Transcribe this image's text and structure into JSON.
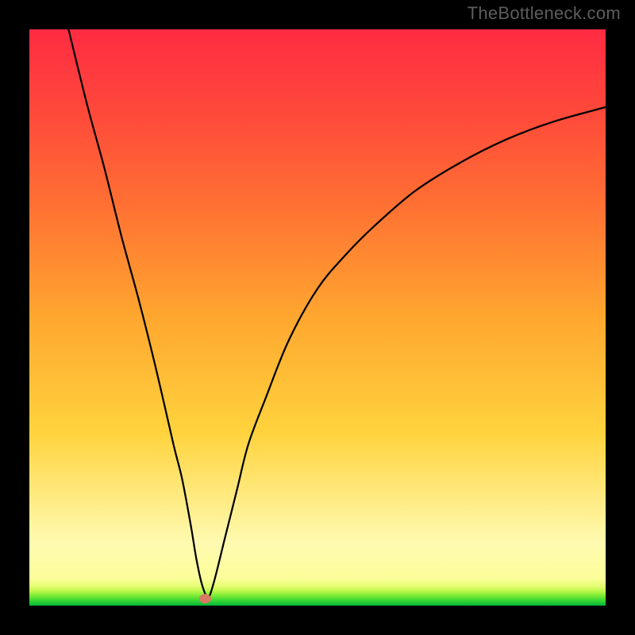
{
  "watermark": "TheBottleneck.com",
  "chart_data": {
    "type": "line",
    "title": "",
    "xlabel": "",
    "ylabel": "",
    "xlim": [
      0,
      100
    ],
    "ylim": [
      0,
      100
    ],
    "description": "V-shaped bottleneck curve on a vertical gradient (green at bottom through yellow/orange to red at top). Single marker dot at the curve minimum.",
    "background_gradient_stops": [
      {
        "pos": 0.0,
        "color": "#03b638"
      },
      {
        "pos": 0.008,
        "color": "#32d434"
      },
      {
        "pos": 0.017,
        "color": "#78ea34"
      },
      {
        "pos": 0.025,
        "color": "#b9f749"
      },
      {
        "pos": 0.034,
        "color": "#e6fd72"
      },
      {
        "pos": 0.048,
        "color": "#fcfe9b"
      },
      {
        "pos": 0.11,
        "color": "#fffab0"
      },
      {
        "pos": 0.3,
        "color": "#ffd33d"
      },
      {
        "pos": 0.5,
        "color": "#ffa72f"
      },
      {
        "pos": 0.7,
        "color": "#ff6f33"
      },
      {
        "pos": 0.85,
        "color": "#ff4a3a"
      },
      {
        "pos": 1.0,
        "color": "#ff2b42"
      }
    ],
    "series": [
      {
        "name": "bottleneck-curve",
        "x": [
          6.8,
          10,
          13,
          16,
          19,
          22,
          25,
          26.5,
          28,
          29,
          30,
          31,
          32,
          34,
          36,
          38,
          41,
          45,
          50,
          55,
          60,
          67,
          75,
          83,
          91,
          100
        ],
        "y": [
          100,
          87,
          76,
          64,
          53,
          41,
          28,
          22,
          14,
          8,
          3.5,
          1.5,
          4,
          12,
          20,
          28,
          36,
          46,
          55,
          61,
          66,
          72,
          77,
          81,
          84,
          86.5
        ]
      }
    ],
    "marker": {
      "x": 30.5,
      "y": 1.2,
      "color": "#d87a63"
    }
  }
}
